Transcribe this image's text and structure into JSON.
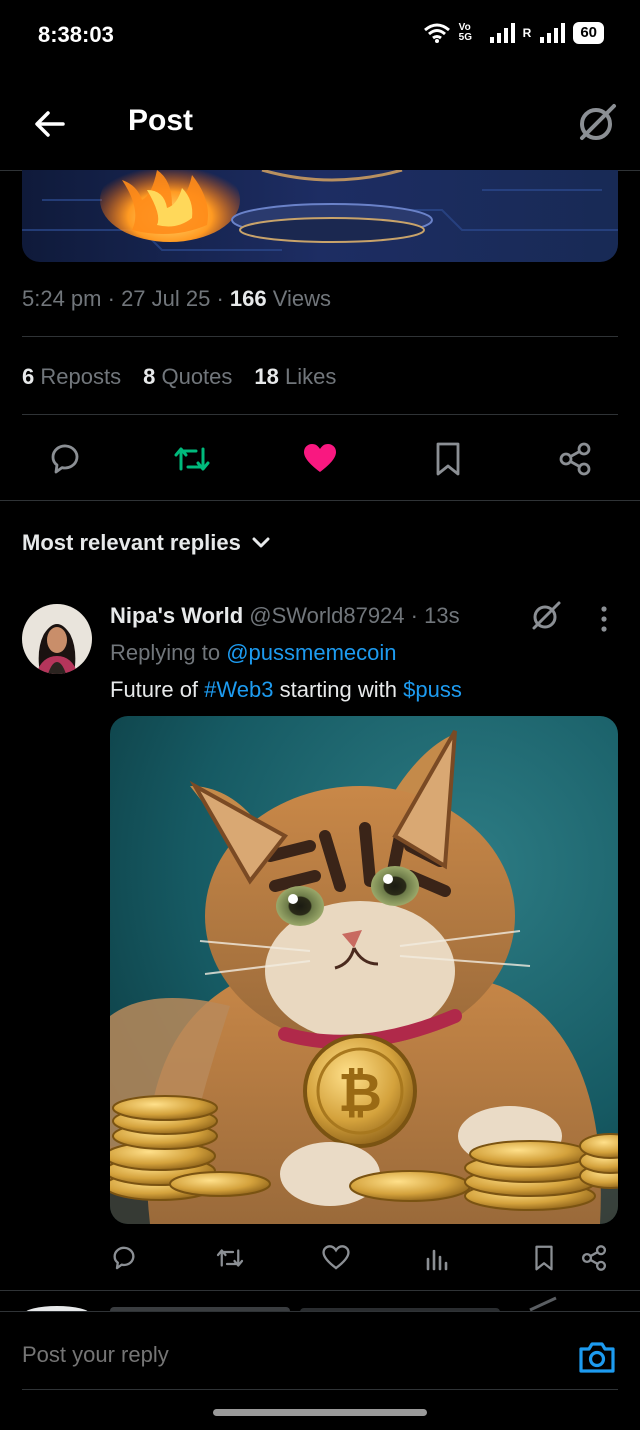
{
  "status_bar": {
    "time": "8:38:03",
    "network_label": "Vo 5G",
    "sim2_label": "R",
    "battery": "60"
  },
  "header": {
    "title": "Post"
  },
  "post": {
    "time": "5:24 pm",
    "date": "27 Jul 25",
    "views_count": "166",
    "views_label": "Views",
    "reposts_count": "6",
    "reposts_label": "Reposts",
    "quotes_count": "8",
    "quotes_label": "Quotes",
    "likes_count": "18",
    "likes_label": "Likes"
  },
  "colors": {
    "accent": "#1d9bf0",
    "like": "#f91880",
    "repost": "#00ba7c",
    "muted": "#71767b",
    "background": "#000000"
  },
  "replies_sort": {
    "label": "Most relevant replies"
  },
  "reply": {
    "name": "Nipa's World",
    "handle": "@SWorld87924",
    "age": "13s",
    "replying_prefix": "Replying to",
    "replying_to": "@pussmemecoin",
    "text_prefix": "Future of",
    "hashtag": "#Web3",
    "text_mid": "starting with",
    "cashtag": "$puss"
  },
  "compose": {
    "placeholder": "Post your reply"
  },
  "icons": {
    "back": "arrow-left-icon",
    "grok": "grok-icon",
    "reply": "reply-icon",
    "repost": "repost-icon",
    "like": "heart-icon",
    "bookmark": "bookmark-icon",
    "share": "share-icon",
    "views": "views-icon",
    "more": "more-vertical-icon",
    "camera": "camera-icon"
  }
}
